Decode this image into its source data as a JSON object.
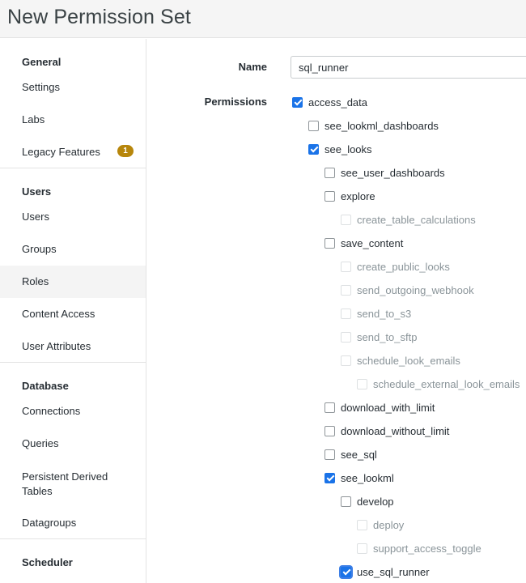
{
  "header": {
    "title": "New Permission Set"
  },
  "sidebar": {
    "sections": [
      {
        "heading": "General",
        "items": [
          {
            "label": "Settings"
          },
          {
            "label": "Labs"
          },
          {
            "label": "Legacy Features",
            "badge": "1"
          }
        ]
      },
      {
        "heading": "Users",
        "items": [
          {
            "label": "Users"
          },
          {
            "label": "Groups"
          },
          {
            "label": "Roles",
            "active": true
          },
          {
            "label": "Content Access"
          },
          {
            "label": "User Attributes"
          }
        ]
      },
      {
        "heading": "Database",
        "items": [
          {
            "label": "Connections"
          },
          {
            "label": "Queries"
          },
          {
            "label": "Persistent Derived Tables"
          },
          {
            "label": "Datagroups"
          }
        ]
      },
      {
        "heading": "Scheduler",
        "items": []
      }
    ],
    "badge_color": "#b7860b"
  },
  "form": {
    "name_label": "Name",
    "name_value": "sql_runner",
    "permissions_label": "Permissions",
    "permissions": [
      {
        "label": "access_data",
        "checked": true,
        "enabled": true
      },
      {
        "label": "see_lookml_dashboards",
        "checked": false,
        "enabled": true
      },
      {
        "label": "see_looks",
        "checked": true,
        "enabled": true
      },
      {
        "label": "see_user_dashboards",
        "checked": false,
        "enabled": true
      },
      {
        "label": "explore",
        "checked": false,
        "enabled": true
      },
      {
        "label": "create_table_calculations",
        "checked": false,
        "enabled": false
      },
      {
        "label": "save_content",
        "checked": false,
        "enabled": true
      },
      {
        "label": "create_public_looks",
        "checked": false,
        "enabled": false
      },
      {
        "label": "send_outgoing_webhook",
        "checked": false,
        "enabled": false
      },
      {
        "label": "send_to_s3",
        "checked": false,
        "enabled": false
      },
      {
        "label": "send_to_sftp",
        "checked": false,
        "enabled": false
      },
      {
        "label": "schedule_look_emails",
        "checked": false,
        "enabled": false
      },
      {
        "label": "schedule_external_look_emails",
        "checked": false,
        "enabled": false
      },
      {
        "label": "download_with_limit",
        "checked": false,
        "enabled": true
      },
      {
        "label": "download_without_limit",
        "checked": false,
        "enabled": true
      },
      {
        "label": "see_sql",
        "checked": false,
        "enabled": true
      },
      {
        "label": "see_lookml",
        "checked": true,
        "enabled": true
      },
      {
        "label": "develop",
        "checked": false,
        "enabled": true
      },
      {
        "label": "deploy",
        "checked": false,
        "enabled": false
      },
      {
        "label": "support_access_toggle",
        "checked": false,
        "enabled": false
      },
      {
        "label": "use_sql_runner",
        "checked": true,
        "enabled": true,
        "focused": true
      }
    ]
  },
  "colors": {
    "checkbox_checked": "#1a73e8",
    "text": "#262d33",
    "disabled_text": "#8a9499"
  }
}
